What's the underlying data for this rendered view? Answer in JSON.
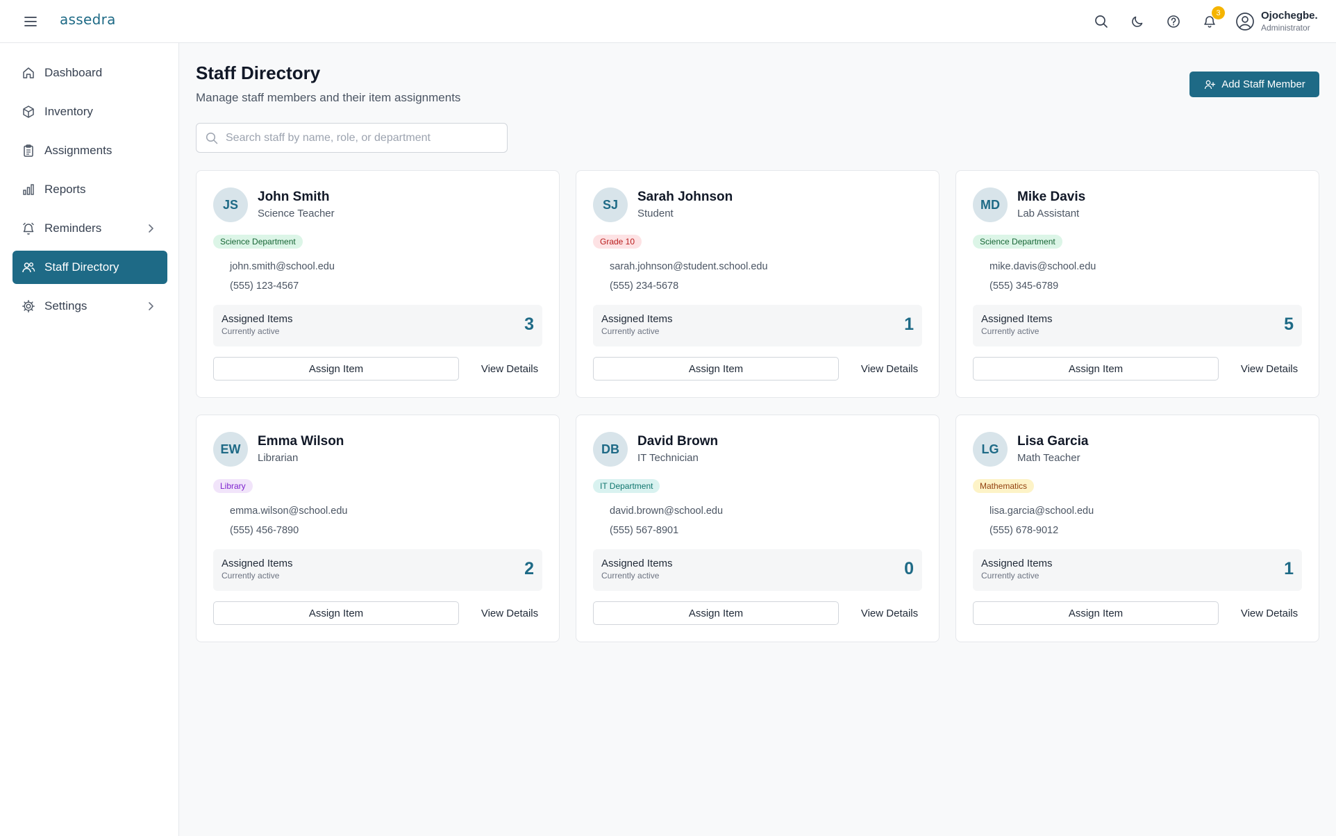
{
  "app": {
    "logo": "assedra"
  },
  "header": {
    "notification_count": "3",
    "user_name": "Ojochegbe.",
    "user_role": "Administrator"
  },
  "sidebar": {
    "items": [
      {
        "label": "Dashboard",
        "icon": "home-icon"
      },
      {
        "label": "Inventory",
        "icon": "box-icon"
      },
      {
        "label": "Assignments",
        "icon": "clipboard-icon"
      },
      {
        "label": "Reports",
        "icon": "bar-chart-icon"
      },
      {
        "label": "Reminders",
        "icon": "bell-icon"
      },
      {
        "label": "Staff Directory",
        "icon": "users-icon"
      },
      {
        "label": "Settings",
        "icon": "gear-icon"
      }
    ]
  },
  "main": {
    "title": "Staff Directory",
    "subtitle": "Manage staff members and their item assignments",
    "add_button": "Add Staff Member",
    "search_placeholder": "Search staff by name, role, or department"
  },
  "cards": [
    {
      "initials": "JS",
      "name": "John Smith",
      "role": "Science Teacher",
      "badge": "Science Department",
      "badge_color": "#dcf5e7",
      "email": "john.smith@school.edu",
      "phone": "(555) 123-4567",
      "assigned_label": "Assigned Items",
      "assigned_sub": "Currently active",
      "count": "3",
      "assign": "Assign Item",
      "details": "View Details"
    },
    {
      "initials": "SJ",
      "name": "Sarah Johnson",
      "role": "Student",
      "badge": "Grade 10",
      "badge_color": "#fde2e4",
      "email": "sarah.johnson@student.school.edu",
      "phone": "(555) 234-5678",
      "assigned_label": "Assigned Items",
      "assigned_sub": "Currently active",
      "count": "1",
      "assign": "Assign Item",
      "details": "View Details"
    },
    {
      "initials": "MD",
      "name": "Mike Davis",
      "role": "Lab Assistant",
      "badge": "Science Department",
      "badge_color": "#dcf5e7",
      "email": "mike.davis@school.edu",
      "phone": "(555) 345-6789",
      "assigned_label": "Assigned Items",
      "assigned_sub": "Currently active",
      "count": "5",
      "assign": "Assign Item",
      "details": "View Details"
    },
    {
      "initials": "EW",
      "name": "Emma Wilson",
      "role": "Librarian",
      "badge": "Library",
      "badge_color": "#f1e4fa",
      "email": "emma.wilson@school.edu",
      "phone": "(555) 456-7890",
      "assigned_label": "Assigned Items",
      "assigned_sub": "Currently active",
      "count": "2",
      "assign": "Assign Item",
      "details": "View Details"
    },
    {
      "initials": "DB",
      "name": "David Brown",
      "role": "IT Technician",
      "badge": "IT Department",
      "badge_color": "#d9f2f0",
      "email": "david.brown@school.edu",
      "phone": "(555) 567-8901",
      "assigned_label": "Assigned Items",
      "assigned_sub": "Currently active",
      "count": "0",
      "assign": "Assign Item",
      "details": "View Details"
    },
    {
      "initials": "LG",
      "name": "Lisa Garcia",
      "role": "Math Teacher",
      "badge": "Mathematics",
      "badge_color": "#fdf3c7",
      "email": "lisa.garcia@school.edu",
      "phone": "(555) 678-9012",
      "assigned_label": "Assigned Items",
      "assigned_sub": "Currently active",
      "count": "1",
      "assign": "Assign Item",
      "details": "View Details"
    }
  ],
  "colors": {
    "accent": "#1e6a86",
    "notification": "#f5b400"
  }
}
